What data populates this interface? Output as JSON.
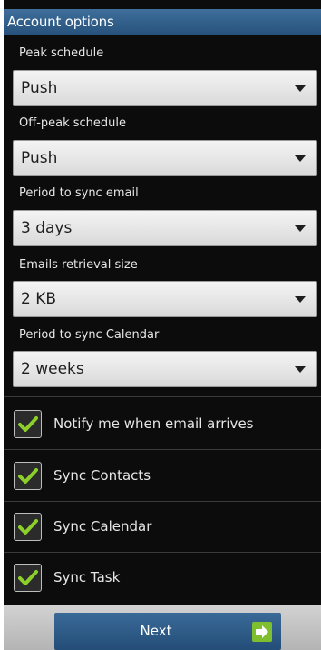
{
  "title": "Account options",
  "dropdowns": [
    {
      "label": "Peak schedule",
      "value": "Push"
    },
    {
      "label": "Off-peak schedule",
      "value": "Push"
    },
    {
      "label": "Period to sync email",
      "value": "3 days"
    },
    {
      "label": "Emails retrieval size",
      "value": "2 KB"
    },
    {
      "label": "Period to sync Calendar",
      "value": "2 weeks"
    }
  ],
  "checkboxes": [
    {
      "label": "Notify me when email arrives",
      "checked": true
    },
    {
      "label": "Sync Contacts",
      "checked": true
    },
    {
      "label": "Sync Calendar",
      "checked": true
    },
    {
      "label": "Sync Task",
      "checked": true
    }
  ],
  "next_label": "Next",
  "icons": {
    "dropdown": "chevron-down-icon",
    "checkbox": "checkmark-icon",
    "next": "arrow-right-icon"
  },
  "colors": {
    "title_bar": "#2f5f8c",
    "background": "#0c0c0c",
    "checkmark": "#8ccf2a",
    "next_button": "#2f5f8c"
  }
}
